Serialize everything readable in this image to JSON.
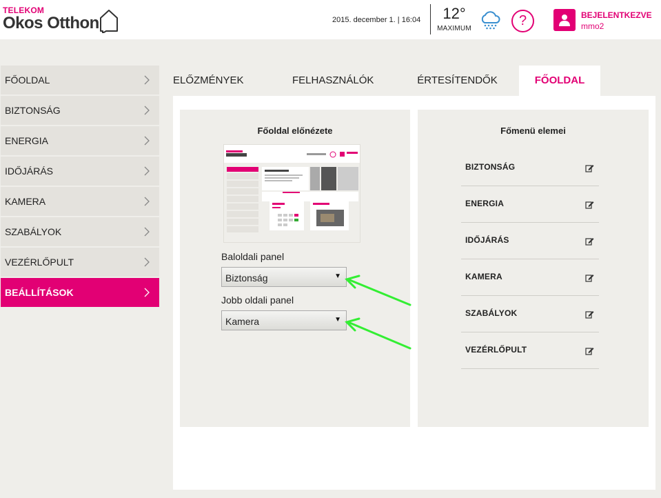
{
  "header": {
    "brand_top": "TELEKOM",
    "brand_main": "Okos Otthon",
    "datetime": "2015. december 1. | 16:04",
    "temperature": "12°",
    "temperature_label": "MAXIMUM",
    "weather_icon": "rain-cloud-icon",
    "help_label": "?",
    "user_status": "BEJELENTKEZVE",
    "user_name": "mmo2"
  },
  "sidebar": {
    "items": [
      {
        "label": "FŐOLDAL"
      },
      {
        "label": "BIZTONSÁG"
      },
      {
        "label": "ENERGIA"
      },
      {
        "label": "IDŐJÁRÁS"
      },
      {
        "label": "KAMERA"
      },
      {
        "label": "SZABÁLYOK"
      },
      {
        "label": "VEZÉRLŐPULT"
      },
      {
        "label": "BEÁLLÍTÁSOK",
        "active": true
      }
    ]
  },
  "tabs": [
    {
      "label": "ELŐZMÉNYEK"
    },
    {
      "label": "FELHASZNÁLÓK"
    },
    {
      "label": "ÉRTESÍTENDŐK"
    },
    {
      "label": "FŐOLDAL",
      "active": true
    }
  ],
  "left_card": {
    "title": "Főoldal előnézete",
    "left_panel_label": "Baloldali panel",
    "left_panel_value": "Biztonság",
    "right_panel_label": "Jobb oldali panel",
    "right_panel_value": "Kamera"
  },
  "right_card": {
    "title": "Főmenü elemei",
    "items": [
      {
        "label": "BIZTONSÁG"
      },
      {
        "label": "ENERGIA"
      },
      {
        "label": "IDŐJÁRÁS"
      },
      {
        "label": "KAMERA"
      },
      {
        "label": "SZABÁLYOK"
      },
      {
        "label": "VEZÉRLŐPULT"
      }
    ]
  },
  "colors": {
    "accent": "#e20074",
    "sidebar_bg": "#e4e2dd",
    "page_bg": "#efeeea",
    "annotation_arrow": "#33ee33"
  }
}
